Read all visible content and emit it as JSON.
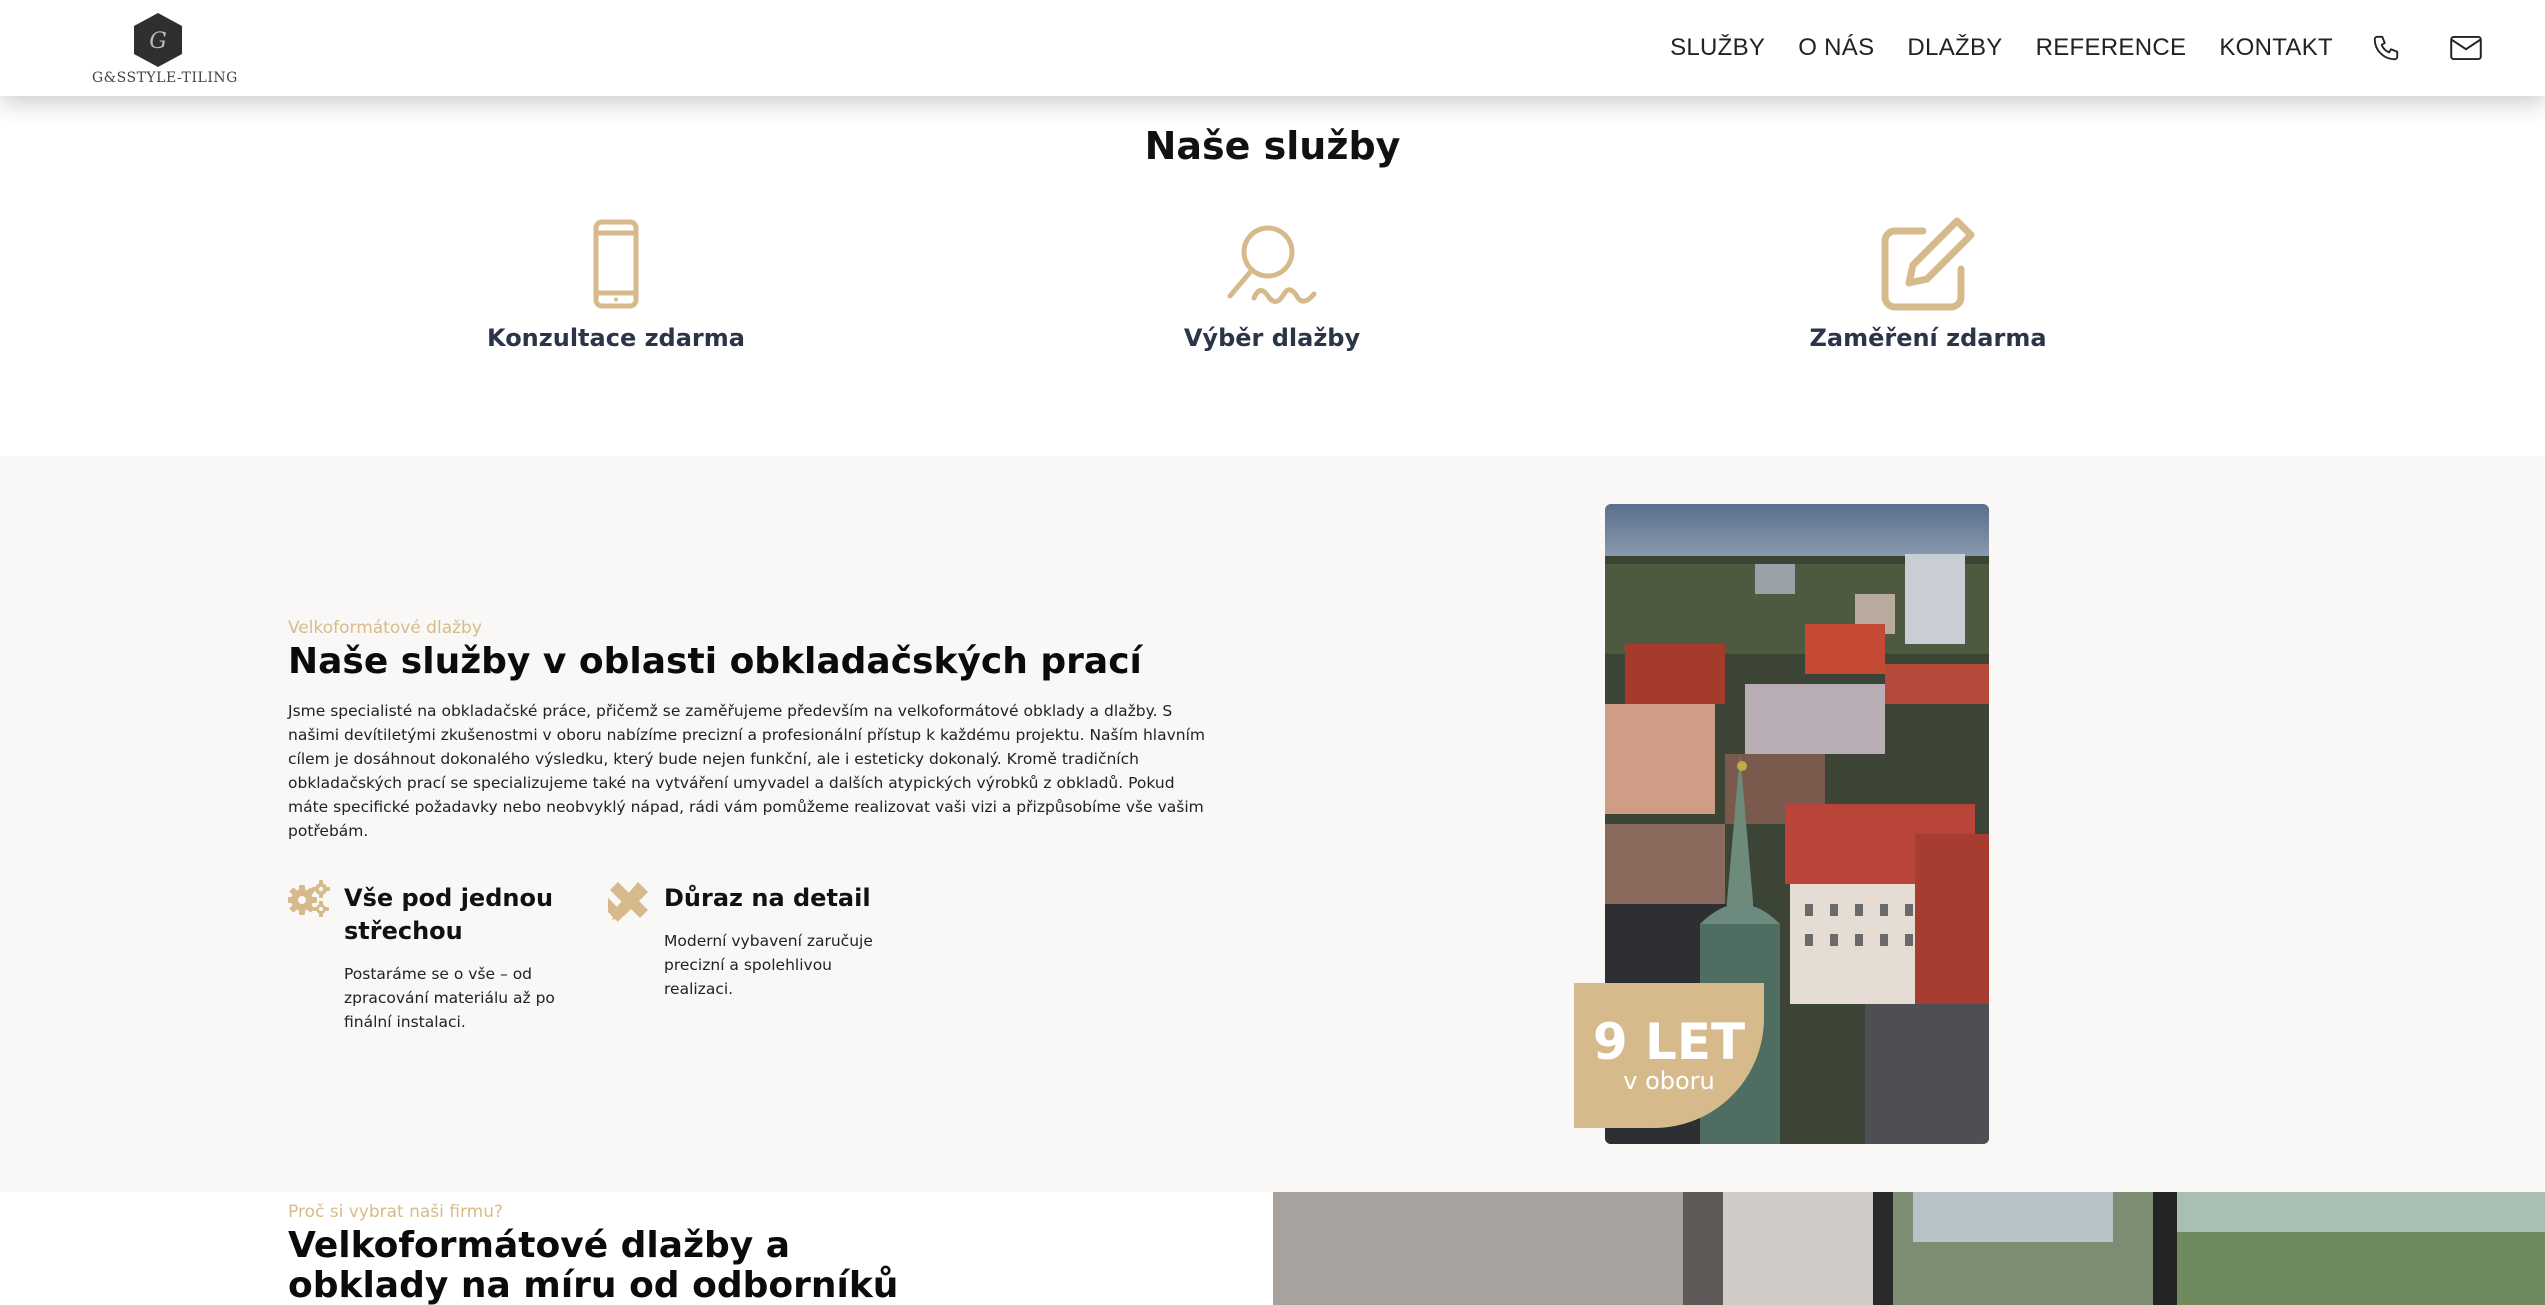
{
  "header": {
    "logo_text": "G&SSTYLE-TILING",
    "nav": [
      "SLUŽBY",
      "O NÁS",
      "DLAŽBY",
      "REFERENCE",
      "KONTAKT"
    ],
    "icons": [
      "phone-icon",
      "mail-icon"
    ]
  },
  "services": {
    "title": "Naše služby",
    "items": [
      {
        "label": "Konzultace zdarma",
        "icon": "smartphone-icon"
      },
      {
        "label": "Výběr dlažby",
        "icon": "search-icon"
      },
      {
        "label": "Zaměření zdarma",
        "icon": "edit-icon"
      }
    ]
  },
  "about": {
    "eyebrow": "Velkoformátové dlažby",
    "title": "Naše služby v oblasti obkladačských prací",
    "text": "Jsme specialisté na obkladačské práce, přičemž se zaměřujeme především na velkoformátové obklady a dlažby. S našimi devítiletými zkušenostmi v oboru nabízíme precizní a profesionální přístup k každému projektu. Naším hlavním cílem je dosáhnout dokonalého výsledku, který bude nejen funkční, ale i esteticky dokonalý. Kromě tradičních obkladačských prací se specializujeme také na vytváření umyvadel a dalších atypických výrobků z obkladů. Pokud máte specifické požadavky nebo neobvyklý nápad, rádi vám pomůžeme realizovat vaši vizi a přizpůsobíme vše vašim potřebám.",
    "features": [
      {
        "title": "Vše pod jednou střechou",
        "text": "Postaráme se o vše – od zpracování materiálu až po finální instalaci.",
        "icon": "gears-icon"
      },
      {
        "title": "Důraz na detail",
        "text": "Moderní vybavení zaručuje precizní a spolehlivou realizaci.",
        "icon": "pencil-ruler-icon"
      }
    ],
    "badge_number": "9 LET",
    "badge_sub": "v oboru"
  },
  "why": {
    "eyebrow": "Proč si vybrat naši firmu?",
    "title": "Velkoformátové dlažby a obklady na míru od odborníků"
  },
  "colors": {
    "accent": "#d6ba8c",
    "heading_dark": "#2c3447",
    "section_bg": "#f9f8f6"
  }
}
